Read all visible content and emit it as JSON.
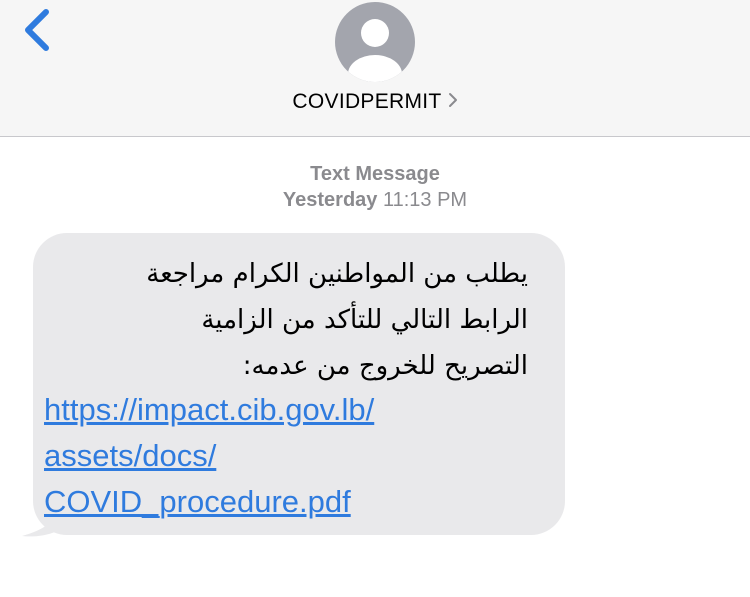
{
  "header": {
    "back_icon": "chevron-left-icon",
    "avatar_icon": "person-icon",
    "contact_name": "COVIDPERMIT",
    "contact_chevron_icon": "chevron-right-icon"
  },
  "thread": {
    "message_type": "Text Message",
    "day": "Yesterday",
    "time": "11:13 PM"
  },
  "message": {
    "text_lines": [
      "يطلب من المواطنين الكرام مراجعة",
      "الرابط التالي للتأكد من الزامية",
      "التصريح للخروج من عدمه:"
    ],
    "link_lines": [
      "https://impact.cib.gov.lb/",
      "assets/docs/",
      "COVID_procedure.pdf"
    ]
  },
  "colors": {
    "accent": "#2f7bde",
    "bubble": "#e9e9eb",
    "header_bg": "#f6f6f6",
    "meta_text": "#8a8a8e",
    "avatar_bg": "#a3a5ad"
  }
}
